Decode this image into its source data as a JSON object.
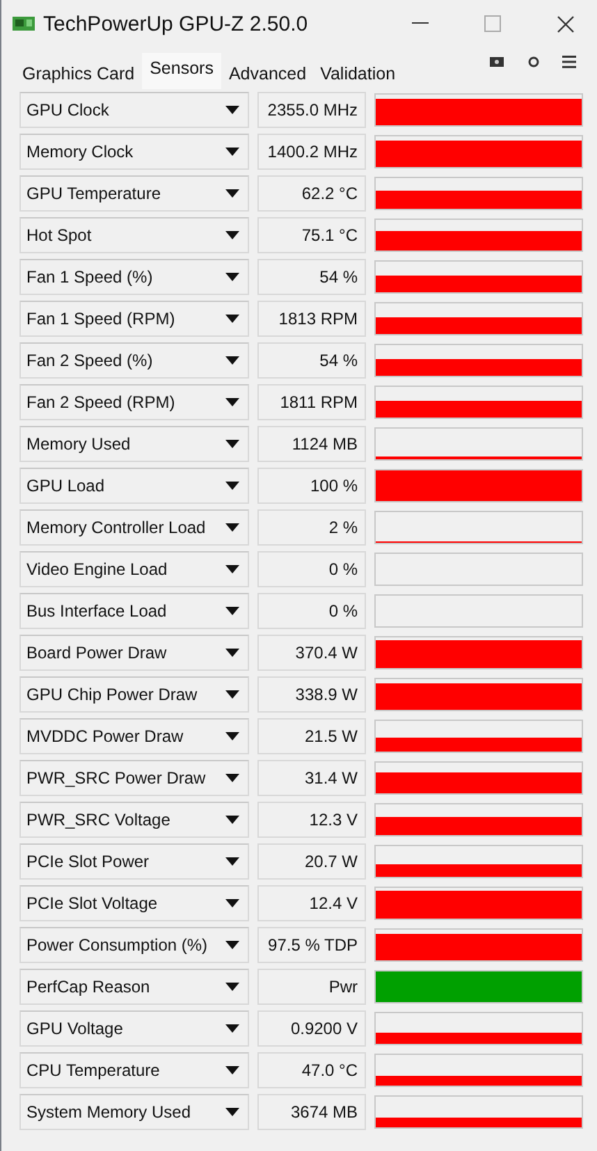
{
  "window": {
    "title": "TechPowerUp GPU-Z 2.50.0"
  },
  "tabs": [
    {
      "label": "Graphics Card",
      "selected": false
    },
    {
      "label": "Sensors",
      "selected": true
    },
    {
      "label": "Advanced",
      "selected": false
    },
    {
      "label": "Validation",
      "selected": false
    }
  ],
  "sensors": [
    {
      "name": "GPU Clock",
      "value": "2355.0 MHz",
      "color": "#ff0000"
    },
    {
      "name": "Memory Clock",
      "value": "1400.2 MHz",
      "color": "#ff0000"
    },
    {
      "name": "GPU Temperature",
      "value": "62.2 °C",
      "color": "#ff0000"
    },
    {
      "name": "Hot Spot",
      "value": "75.1 °C",
      "color": "#ff0000"
    },
    {
      "name": "Fan 1 Speed (%)",
      "value": "54 %",
      "color": "#ff0000"
    },
    {
      "name": "Fan 1 Speed (RPM)",
      "value": "1813 RPM",
      "color": "#ff0000"
    },
    {
      "name": "Fan 2 Speed (%)",
      "value": "54 %",
      "color": "#ff0000"
    },
    {
      "name": "Fan 2 Speed (RPM)",
      "value": "1811 RPM",
      "color": "#ff0000"
    },
    {
      "name": "Memory Used",
      "value": "1124 MB",
      "color": "#ff0000"
    },
    {
      "name": "GPU Load",
      "value": "100 %",
      "color": "#ff0000"
    },
    {
      "name": "Memory Controller Load",
      "value": "2 %",
      "color": "#ff0000"
    },
    {
      "name": "Video Engine Load",
      "value": "0 %"
    },
    {
      "name": "Bus Interface Load",
      "value": "0 %"
    },
    {
      "name": "Board Power Draw",
      "value": "370.4 W",
      "color": "#ff0000"
    },
    {
      "name": "GPU Chip Power Draw",
      "value": "338.9 W",
      "color": "#ff0000"
    },
    {
      "name": "MVDDC Power Draw",
      "value": "21.5 W",
      "color": "#ff0000"
    },
    {
      "name": "PWR_SRC Power Draw",
      "value": "31.4 W",
      "color": "#ff0000"
    },
    {
      "name": "PWR_SRC Voltage",
      "value": "12.3 V",
      "color": "#ff0000"
    },
    {
      "name": "PCIe Slot Power",
      "value": "20.7 W",
      "color": "#ff0000"
    },
    {
      "name": "PCIe Slot Voltage",
      "value": "12.4 V",
      "color": "#ff0000"
    },
    {
      "name": "Power Consumption (%)",
      "value": "97.5 % TDP",
      "color": "#ff0000"
    },
    {
      "name": "PerfCap Reason",
      "value": "Pwr",
      "color": "#00a000"
    },
    {
      "name": "GPU Voltage",
      "value": "0.9200 V",
      "color": "#ff0000"
    },
    {
      "name": "CPU Temperature",
      "value": "47.0 °C",
      "color": "#ff0000"
    },
    {
      "name": "System Memory Used",
      "value": "3674 MB",
      "color": "#ff0000"
    }
  ]
}
